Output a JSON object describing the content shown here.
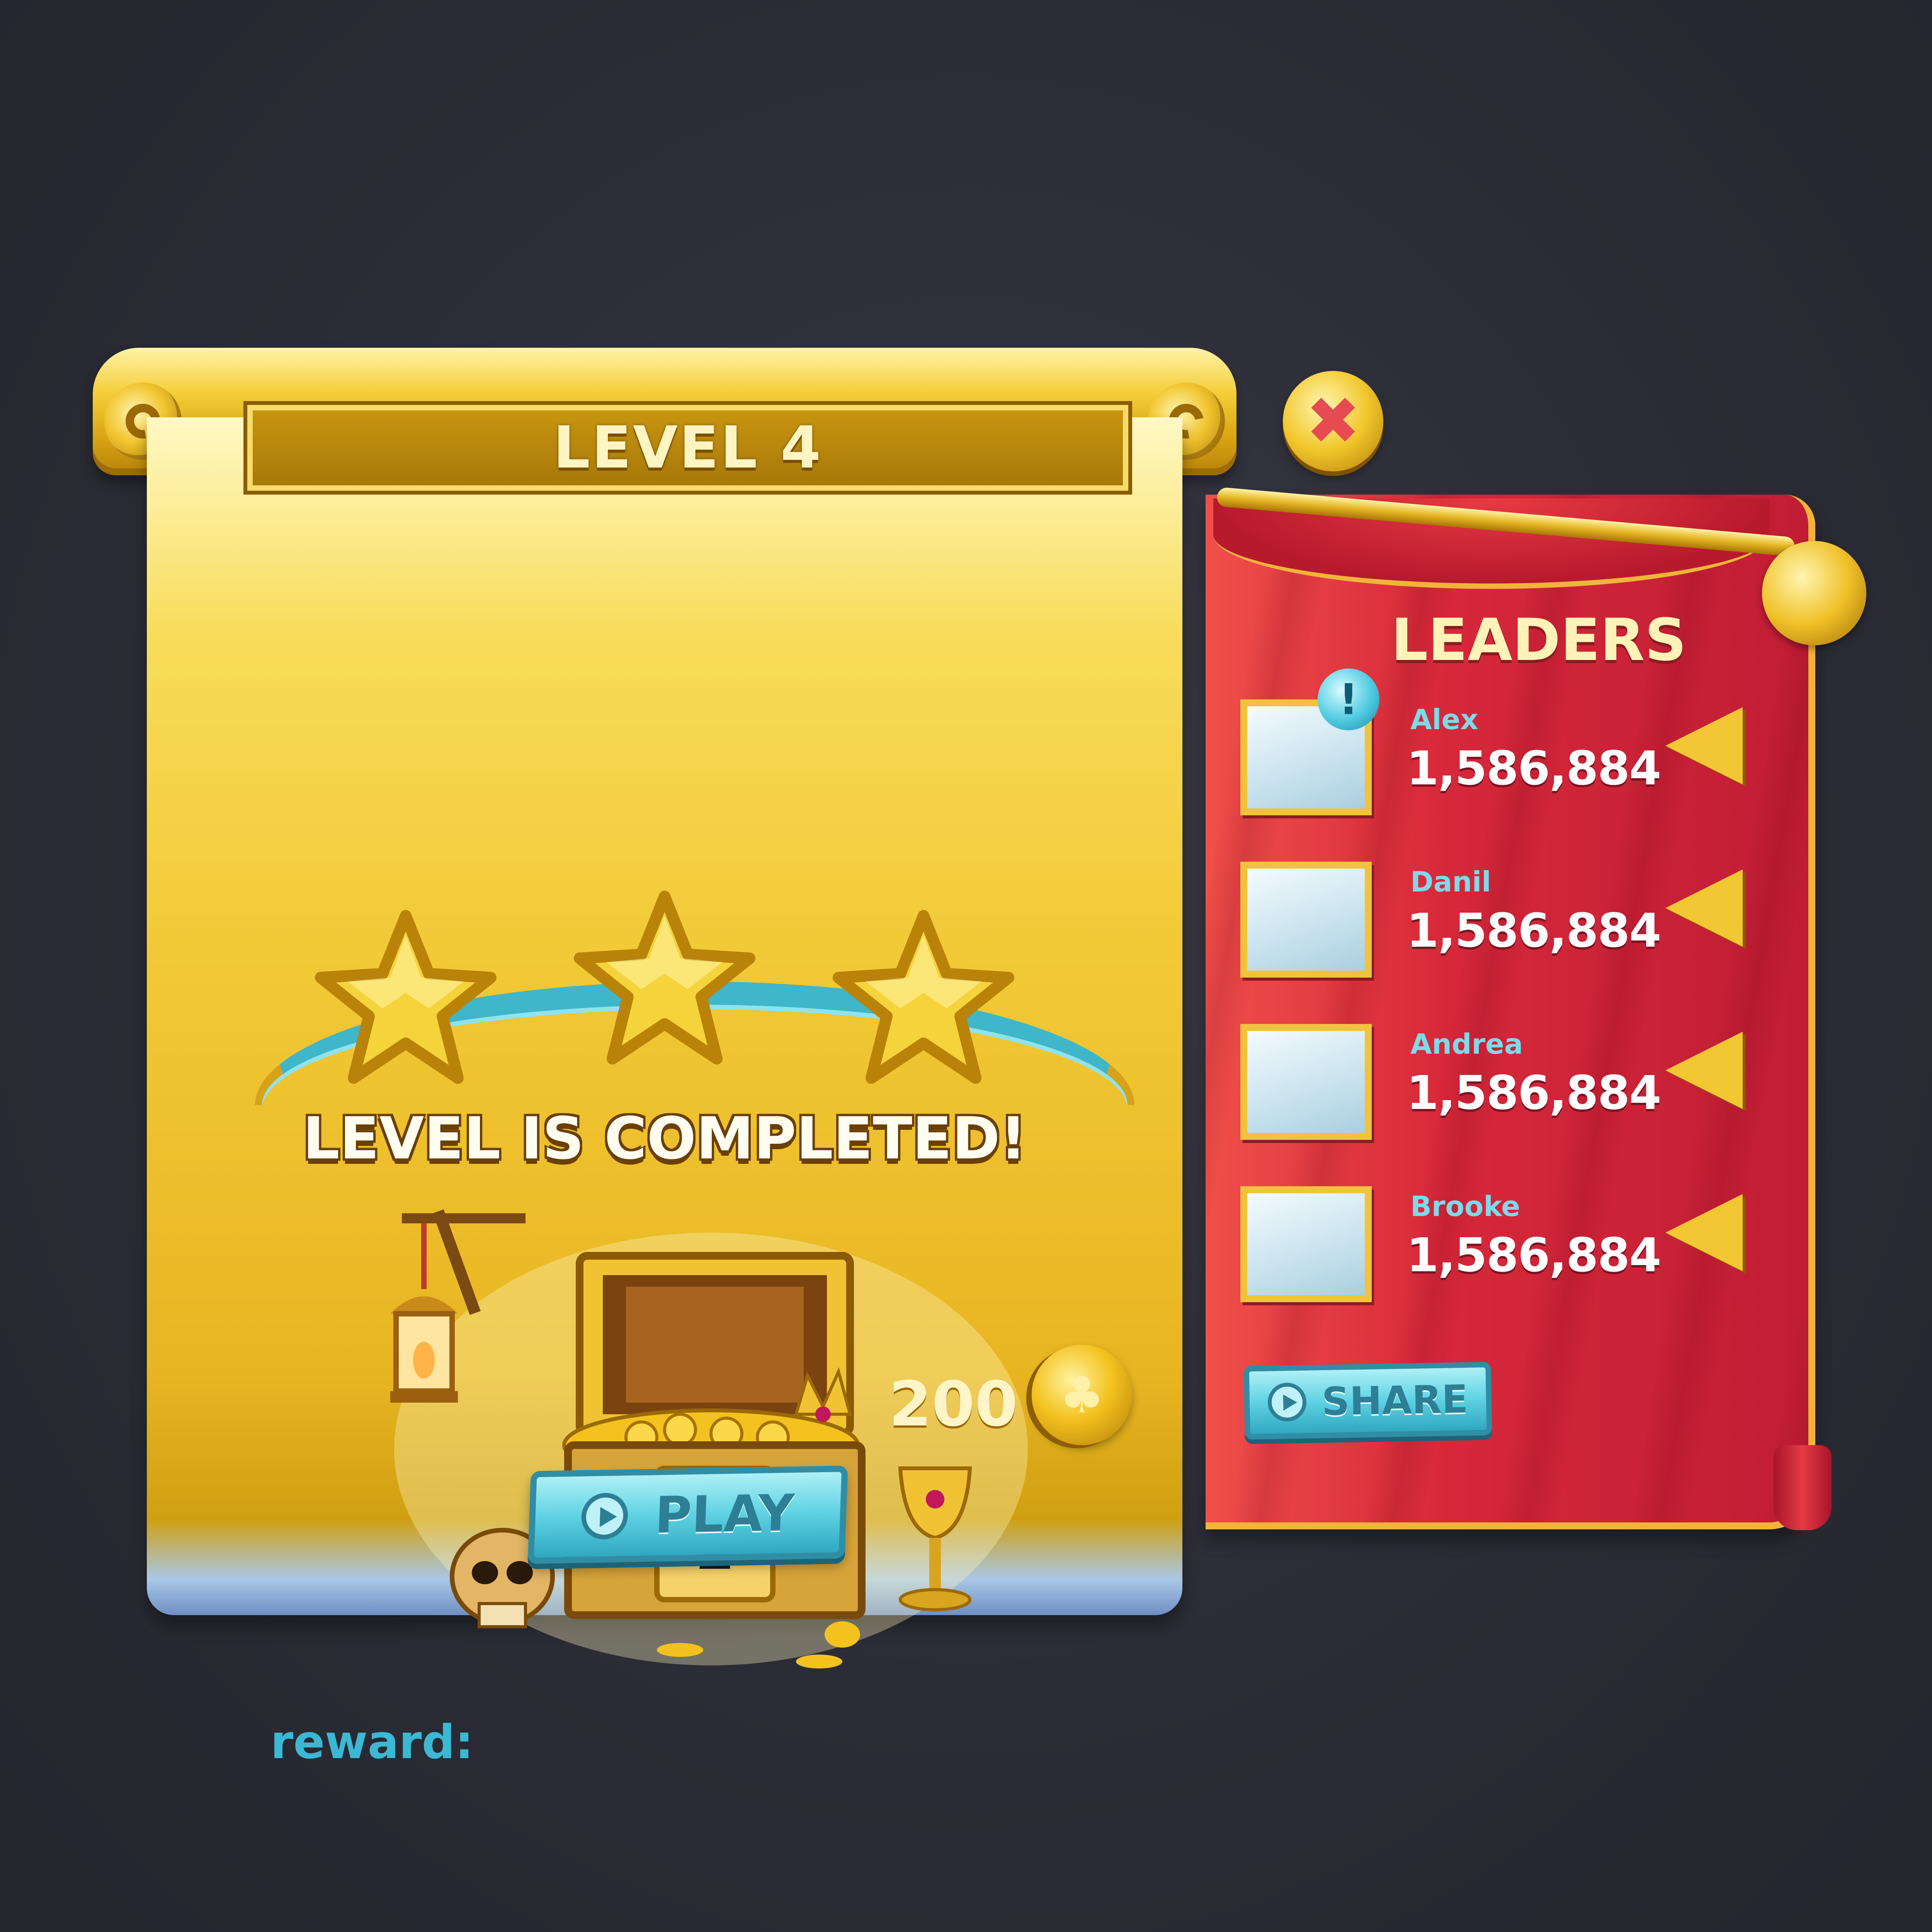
{
  "level_window": {
    "title": "LEVEL 4",
    "stars_earned": 3,
    "stars_total": 3,
    "status_text": "LEVEL IS COMPLETED!",
    "reward_label": "reward:",
    "reward_value": "200",
    "play_label": "PLAY",
    "close_icon": "close-icon",
    "coin_icon": "clover-coin-icon"
  },
  "leaders": {
    "title": "LEADERS",
    "info_badge": "!",
    "entries": [
      {
        "name": "Alex",
        "score": "1,586,884"
      },
      {
        "name": "Danil",
        "score": "1,586,884"
      },
      {
        "name": "Andrea",
        "score": "1,586,884"
      },
      {
        "name": "Brooke",
        "score": "1,586,884"
      }
    ],
    "share_label": "SHARE"
  },
  "colors": {
    "gold": "#f2c936",
    "curtain_red": "#d7283a",
    "button_cyan": "#5fd2e3",
    "reward_label_blue": "#3bb8d4",
    "background": "#2c2c36"
  }
}
